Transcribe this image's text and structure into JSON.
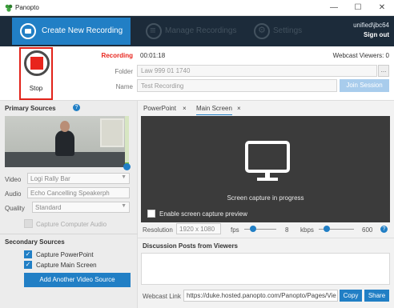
{
  "window": {
    "title": "Panopto",
    "minimize": "—",
    "maximize": "☐",
    "close": "✕"
  },
  "nav": {
    "create_label": "Create New Recording",
    "manage_label": "Manage Recordings",
    "settings_label": "Settings",
    "user": "unified\\jbc64",
    "sign_out": "Sign out"
  },
  "recording": {
    "stop_label": "Stop",
    "status_label": "Recording",
    "elapsed": "00:01:18",
    "viewers": "Webcast Viewers: 0",
    "folder_label": "Folder",
    "folder_value": "Law 999 01 1740",
    "folder_button": "...",
    "name_label": "Name",
    "name_value": "Test Recording",
    "join_button": "Join Session"
  },
  "primary_sources": {
    "title": "Primary Sources",
    "help": "?",
    "video_label": "Video",
    "video_value": "Logi Rally Bar",
    "audio_label": "Audio",
    "audio_value": "Echo Cancelling Speakerph",
    "quality_label": "Quality",
    "quality_value": "Standard",
    "capture_audio_label": "Capture Computer Audio"
  },
  "secondary_sources": {
    "title": "Secondary Sources",
    "items": [
      {
        "label": "Capture PowerPoint",
        "checked": true
      },
      {
        "label": "Capture Main Screen",
        "checked": true
      }
    ],
    "add_button": "Add Another Video Source"
  },
  "source_tabs": [
    {
      "label": "PowerPoint",
      "close": "×"
    },
    {
      "label": "Main Screen",
      "close": "×"
    }
  ],
  "capture": {
    "status": "Screen capture in progress",
    "preview_label": "Enable screen capture preview",
    "resolution_label": "Resolution",
    "resolution_value": "1920 x 1080",
    "fps_label": "fps",
    "fps_value": "8",
    "kbps_label": "kbps",
    "kbps_value": "600",
    "help": "?"
  },
  "discussion": {
    "title": "Discussion Posts from Viewers"
  },
  "webcast": {
    "label": "Webcast Link",
    "url": "https://duke.hosted.panopto.com/Panopto/Pages/Vie",
    "copy": "Copy",
    "share": "Share"
  },
  "colors": {
    "accent": "#217fc5",
    "nav_bg": "#1c2b3a",
    "record_red": "#e8251d"
  }
}
